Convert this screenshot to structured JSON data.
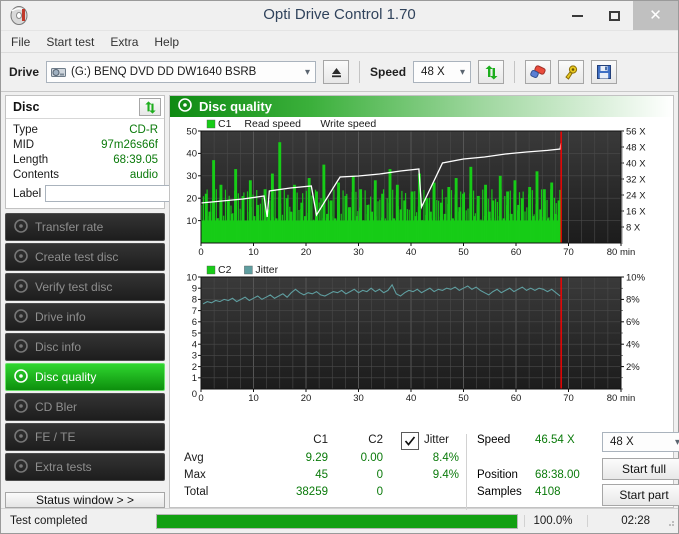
{
  "window": {
    "title": "Opti Drive Control 1.70",
    "minimize_label": "–",
    "maximize_label": "□",
    "close_label": "×"
  },
  "menu": {
    "items": [
      "File",
      "Start test",
      "Extra",
      "Help"
    ]
  },
  "toolbar": {
    "drive_label": "Drive",
    "drive_value": "(G:)   BENQ DVD DD DW1640 BSRB",
    "eject_icon": "eject-icon",
    "speed_label": "Speed",
    "speed_value": "48 X",
    "refresh_icon": "refresh-icon",
    "erase_icon": "erase-icon",
    "tools_icon": "tools-icon",
    "save_icon": "save-icon"
  },
  "disc": {
    "panel_title": "Disc",
    "refresh_icon": "refresh-icon",
    "rows": [
      {
        "key": "Type",
        "value": "CD-R"
      },
      {
        "key": "MID",
        "value": "97m26s66f"
      },
      {
        "key": "Length",
        "value": "68:39.05"
      },
      {
        "key": "Contents",
        "value": "audio"
      }
    ],
    "label_key": "Label",
    "label_value": "",
    "label_placeholder": "",
    "disc_icon": "disc-icon"
  },
  "sidebar": {
    "items": [
      {
        "label": "Transfer rate",
        "icon": "disc-icon",
        "active": false
      },
      {
        "label": "Create test disc",
        "icon": "disc-icon",
        "active": false
      },
      {
        "label": "Verify test disc",
        "icon": "disc-icon",
        "active": false
      },
      {
        "label": "Drive info",
        "icon": "disc-icon",
        "active": false
      },
      {
        "label": "Disc info",
        "icon": "disc-icon",
        "active": false
      },
      {
        "label": "Disc quality",
        "icon": "disc-icon",
        "active": true
      },
      {
        "label": "CD Bler",
        "icon": "disc-icon",
        "active": false
      },
      {
        "label": "FE / TE",
        "icon": "disc-icon",
        "active": false
      },
      {
        "label": "Extra tests",
        "icon": "disc-icon",
        "active": false
      }
    ],
    "status_window_label": "Status window > >"
  },
  "content": {
    "header_title": "Disc quality",
    "header_icon": "disc-icon"
  },
  "stats": {
    "col_c1": "C1",
    "col_c2": "C2",
    "jitter_label": "Jitter",
    "jitter_checked": true,
    "rows": [
      {
        "name": "Avg",
        "c1": "9.29",
        "c2": "0.00",
        "jitter": "8.4%"
      },
      {
        "name": "Max",
        "c1": "45",
        "c2": "0",
        "jitter": "9.4%"
      },
      {
        "name": "Total",
        "c1": "38259",
        "c2": "0",
        "jitter": ""
      }
    ],
    "speed_label": "Speed",
    "speed_value": "46.54 X",
    "position_label": "Position",
    "position_value": "68:38.00",
    "samples_label": "Samples",
    "samples_value": "4108",
    "speed_select_value": "48 X",
    "start_full_label": "Start full",
    "start_part_label": "Start part"
  },
  "statusbar": {
    "message": "Test completed",
    "percent_text": "100.0%",
    "percent_value": 100,
    "elapsed": "02:28"
  },
  "colors": {
    "c1_green": "#17cc17",
    "read_speed_white": "#ffffff",
    "write_speed_gray": "#e8e8e8",
    "jitter_teal": "#5f9ea0",
    "cursor_red": "#ff0000",
    "chart_bg": "#2b2b2b",
    "value_green": "#0a7a0a",
    "accent_green": "#12a012"
  },
  "chart_data": [
    {
      "type": "bar",
      "title": "C1 error rate / Read speed",
      "xlabel": "min",
      "ylabel": "C1",
      "y2label": "X",
      "xlim": [
        0,
        80
      ],
      "ylim": [
        0,
        50
      ],
      "y2lim": [
        0,
        56
      ],
      "xticks": [
        0,
        10,
        20,
        30,
        40,
        50,
        60,
        70,
        80
      ],
      "xticklabels": [
        "0",
        "10",
        "20",
        "30",
        "40",
        "50",
        "60",
        "70",
        "80 min"
      ],
      "yticks": [
        10,
        20,
        30,
        40,
        50
      ],
      "y2ticks": [
        8,
        16,
        24,
        32,
        40,
        48,
        56
      ],
      "y2ticklabels": [
        "8 X",
        "16 X",
        "24 X",
        "32 X",
        "40 X",
        "48 X",
        "56 X"
      ],
      "grid": true,
      "legend": [
        "C1",
        "Read speed",
        "Write speed"
      ],
      "legend_position": "top-left",
      "data_end_x": 68.6,
      "cursor_x": 68.6,
      "series": [
        {
          "name": "C1",
          "type": "bar",
          "color": "#17cc17",
          "x": [
            0.3,
            1.0,
            1.7,
            2.4,
            3.1,
            3.8,
            4.5,
            5.2,
            5.9,
            6.6,
            7.3,
            8.0,
            8.7,
            9.4,
            10.1,
            10.8,
            11.5,
            12.2,
            12.9,
            13.6,
            14.3,
            15.0,
            15.7,
            16.4,
            17.1,
            17.8,
            18.5,
            19.2,
            19.9,
            20.6,
            21.3,
            22.0,
            22.7,
            23.4,
            24.1,
            24.8,
            25.5,
            26.2,
            26.9,
            27.6,
            28.3,
            29.0,
            29.7,
            30.4,
            31.1,
            31.8,
            32.5,
            33.2,
            33.9,
            34.6,
            35.3,
            36.0,
            36.7,
            37.4,
            38.1,
            38.8,
            39.5,
            40.2,
            40.9,
            41.6,
            42.3,
            43.0,
            43.7,
            44.4,
            45.1,
            45.8,
            46.5,
            47.2,
            47.9,
            48.6,
            49.3,
            50.0,
            50.7,
            51.4,
            52.1,
            52.8,
            53.5,
            54.2,
            54.9,
            55.6,
            56.3,
            57.0,
            57.7,
            58.4,
            59.1,
            59.8,
            60.5,
            61.2,
            61.9,
            62.6,
            63.3,
            64.0,
            64.7,
            65.4,
            66.1,
            66.8,
            67.5,
            68.2
          ],
          "values": [
            9,
            22,
            14,
            37,
            11,
            26,
            8,
            19,
            13,
            33,
            10,
            21,
            7,
            28,
            12,
            17,
            9,
            24,
            15,
            31,
            11,
            45,
            9,
            20,
            14,
            26,
            8,
            18,
            12,
            29,
            10,
            23,
            7,
            35,
            13,
            19,
            11,
            27,
            9,
            21,
            16,
            30,
            12,
            24,
            8,
            17,
            14,
            28,
            10,
            22,
            9,
            33,
            11,
            26,
            15,
            19,
            8,
            23,
            12,
            31,
            10,
            20,
            14,
            27,
            9,
            18,
            13,
            25,
            11,
            29,
            16,
            22,
            8,
            34,
            12,
            21,
            10,
            26,
            14,
            19,
            9,
            30,
            11,
            23,
            13,
            28,
            17,
            20,
            10,
            25,
            12,
            32,
            15,
            24,
            11,
            27,
            13,
            19
          ]
        },
        {
          "name": "Read speed",
          "type": "line",
          "color": "#ffffff",
          "x": [
            0,
            4,
            8,
            12,
            12.6,
            13,
            17,
            21,
            22,
            26,
            26.5,
            30,
            34,
            38,
            41.5,
            42,
            46,
            50,
            54,
            58,
            62,
            66,
            68.4,
            68.6
          ],
          "values_x_speed": [
            20.0,
            21.0,
            22.0,
            23.5,
            13.0,
            26.0,
            27.5,
            28.5,
            14.0,
            31.0,
            33.0,
            33.5,
            34.5,
            36.0,
            37.0,
            18.0,
            40.0,
            42.0,
            43.0,
            44.5,
            45.5,
            46.3,
            47.0,
            50.0
          ]
        },
        {
          "name": "Write speed",
          "type": "line",
          "color": "#e8e8e8",
          "x": [],
          "values": []
        }
      ]
    },
    {
      "type": "line",
      "title": "C2 errors / Jitter",
      "xlabel": "min",
      "ylabel": "C2",
      "y2label": "%",
      "xlim": [
        0,
        80
      ],
      "ylim": [
        0,
        10
      ],
      "y2lim": [
        0,
        10
      ],
      "xticks": [
        0,
        10,
        20,
        30,
        40,
        50,
        60,
        70,
        80
      ],
      "xticklabels": [
        "0",
        "10",
        "20",
        "30",
        "40",
        "50",
        "60",
        "70",
        "80 min"
      ],
      "yticks": [
        1,
        2,
        3,
        4,
        5,
        6,
        7,
        8,
        9,
        10
      ],
      "y2ticks": [
        2,
        4,
        6,
        8,
        10
      ],
      "y2ticklabels": [
        "2%",
        "4%",
        "6%",
        "8%",
        "10%"
      ],
      "grid": true,
      "legend": [
        "C2",
        "Jitter"
      ],
      "legend_position": "top-left",
      "data_end_x": 68.6,
      "cursor_x": 68.6,
      "series": [
        {
          "name": "C2",
          "type": "bar",
          "color": "#17cc17",
          "x": [],
          "values": []
        },
        {
          "name": "Jitter",
          "type": "line",
          "color": "#5f9ea0",
          "x": [
            0.4,
            1.2,
            2.0,
            2.8,
            3.6,
            4.4,
            5.2,
            6.0,
            6.8,
            7.6,
            8.4,
            9.2,
            10.0,
            10.8,
            11.6,
            12.4,
            13.2,
            14.0,
            14.8,
            15.6,
            16.4,
            17.2,
            18.0,
            18.8,
            19.6,
            20.4,
            21.2,
            22.0,
            22.8,
            23.6,
            24.4,
            25.2,
            26.0,
            26.8,
            27.6,
            28.4,
            29.2,
            30.0,
            30.8,
            31.6,
            32.4,
            33.2,
            34.0,
            34.8,
            35.6,
            36.4,
            37.2,
            38.0,
            38.8,
            39.6,
            40.4,
            41.2,
            42.0,
            42.8,
            43.6,
            44.4,
            45.2,
            46.0,
            46.8,
            47.6,
            48.4,
            49.2,
            50.0,
            50.8,
            51.6,
            52.4,
            53.2,
            54.0,
            54.8,
            55.6,
            56.4,
            57.2,
            58.0,
            58.8,
            59.6,
            60.4,
            61.2,
            62.0,
            62.8,
            63.6,
            64.4,
            65.2,
            66.0,
            66.8,
            67.6,
            68.4
          ],
          "values": [
            7.6,
            7.8,
            7.7,
            7.9,
            7.8,
            8.0,
            7.9,
            8.1,
            7.8,
            8.0,
            8.2,
            7.9,
            8.1,
            8.3,
            8.0,
            8.2,
            8.4,
            8.1,
            8.3,
            8.5,
            8.2,
            8.6,
            8.9,
            8.6,
            8.4,
            8.6,
            8.5,
            8.7,
            8.4,
            8.3,
            8.5,
            8.7,
            8.6,
            8.8,
            8.5,
            8.7,
            8.9,
            8.6,
            8.8,
            8.7,
            9.0,
            8.7,
            8.9,
            8.6,
            8.8,
            9.3,
            8.5,
            8.3,
            8.6,
            8.8,
            8.7,
            8.9,
            8.6,
            8.8,
            9.0,
            8.7,
            8.9,
            8.8,
            9.0,
            8.9,
            9.1,
            8.8,
            9.0,
            9.2,
            8.9,
            9.1,
            8.8,
            8.6,
            8.4,
            8.7,
            8.9,
            8.6,
            8.8,
            9.0,
            8.7,
            8.9,
            9.1,
            8.8,
            9.0,
            8.8,
            9.0,
            8.9,
            8.7,
            8.9,
            8.6,
            8.3
          ]
        }
      ]
    }
  ]
}
